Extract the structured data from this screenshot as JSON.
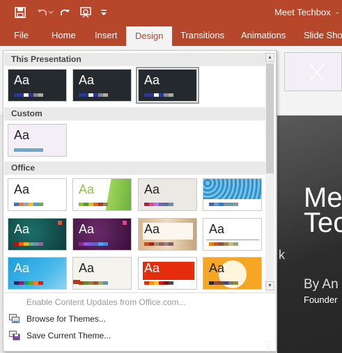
{
  "app": {
    "title": "Meet Techbox",
    "title_clip": "-",
    "accent": "#b7472a"
  },
  "qat": {
    "save_icon": "save-icon",
    "undo_icon": "undo-icon",
    "redo_icon": "redo-icon",
    "present_icon": "present-from-start-icon",
    "customize_icon": "customize-qat-icon"
  },
  "tabs": [
    {
      "label": "File"
    },
    {
      "label": "Home"
    },
    {
      "label": "Insert"
    },
    {
      "label": "Design"
    },
    {
      "label": "Transitions"
    },
    {
      "label": "Animations"
    },
    {
      "label": "Slide Show"
    }
  ],
  "gallery": {
    "sections": [
      {
        "label": "This Presentation"
      },
      {
        "label": "Custom"
      },
      {
        "label": "Office"
      }
    ],
    "thumb_text": "Aa"
  },
  "menu": {
    "enable_updates": "Enable Content Updates from Office.com...",
    "browse": "Browse for Themes...",
    "save": "Save Current Theme..."
  },
  "slide": {
    "line1": "Me",
    "line2": "Tec",
    "line3": "By An",
    "line4": "Founder",
    "side_char": "k"
  }
}
